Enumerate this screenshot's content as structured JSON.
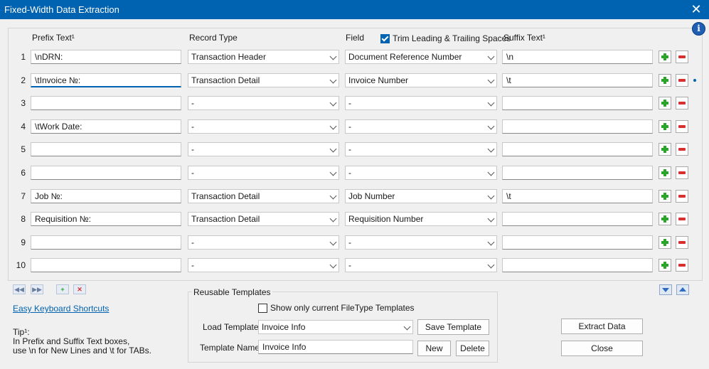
{
  "window": {
    "title": "Fixed-Width Data Extraction",
    "close_glyph": "✕"
  },
  "info_glyph": "i",
  "headers": {
    "prefix": "Prefix Text¹",
    "record_type": "Record Type",
    "field": "Field",
    "trim": "Trim Leading & Trailing Spaces",
    "trim_checked": true,
    "suffix": "Suffix Text¹"
  },
  "rows": [
    {
      "num": "1",
      "prefix": "\\nDRN:",
      "record": "Transaction Header",
      "field": "Document Reference Number",
      "suffix": "\\n"
    },
    {
      "num": "2",
      "prefix": "\\tInvoice №:",
      "record": "Transaction Detail",
      "field": "Invoice Number",
      "suffix": "\\t"
    },
    {
      "num": "3",
      "prefix": "",
      "record": "-",
      "field": "-",
      "suffix": ""
    },
    {
      "num": "4",
      "prefix": "\\tWork Date:",
      "record": "-",
      "field": "-",
      "suffix": ""
    },
    {
      "num": "5",
      "prefix": "",
      "record": "-",
      "field": "-",
      "suffix": ""
    },
    {
      "num": "6",
      "prefix": "",
      "record": "-",
      "field": "-",
      "suffix": ""
    },
    {
      "num": "7",
      "prefix": "Job №:",
      "record": "Transaction Detail",
      "field": "Job Number",
      "suffix": "\\t"
    },
    {
      "num": "8",
      "prefix": "Requisition №:",
      "record": "Transaction Detail",
      "field": "Requisition Number",
      "suffix": ""
    },
    {
      "num": "9",
      "prefix": "",
      "record": "-",
      "field": "-",
      "suffix": ""
    },
    {
      "num": "10",
      "prefix": "",
      "record": "-",
      "field": "-",
      "suffix": ""
    }
  ],
  "shortcuts_link": "Easy Keyboard Shortcuts",
  "tip": "Tip¹:\nIn Prefix and Suffix Text boxes,\nuse \\n for New Lines and \\t for TABs.",
  "templates": {
    "legend": "Reusable Templates",
    "show_only_label": "Show only current FileType Templates",
    "show_only_checked": false,
    "load_label": "Load Template:",
    "load_value": "Invoice Info",
    "save_button": "Save Template",
    "name_label": "Template Name:",
    "name_value": "Invoice Info",
    "new_button": "New",
    "delete_button": "Delete"
  },
  "actions": {
    "extract": "Extract Data",
    "close": "Close"
  },
  "colors": {
    "titlebar": "#0063b1",
    "add": "#2aa52a",
    "remove": "#d83030"
  }
}
